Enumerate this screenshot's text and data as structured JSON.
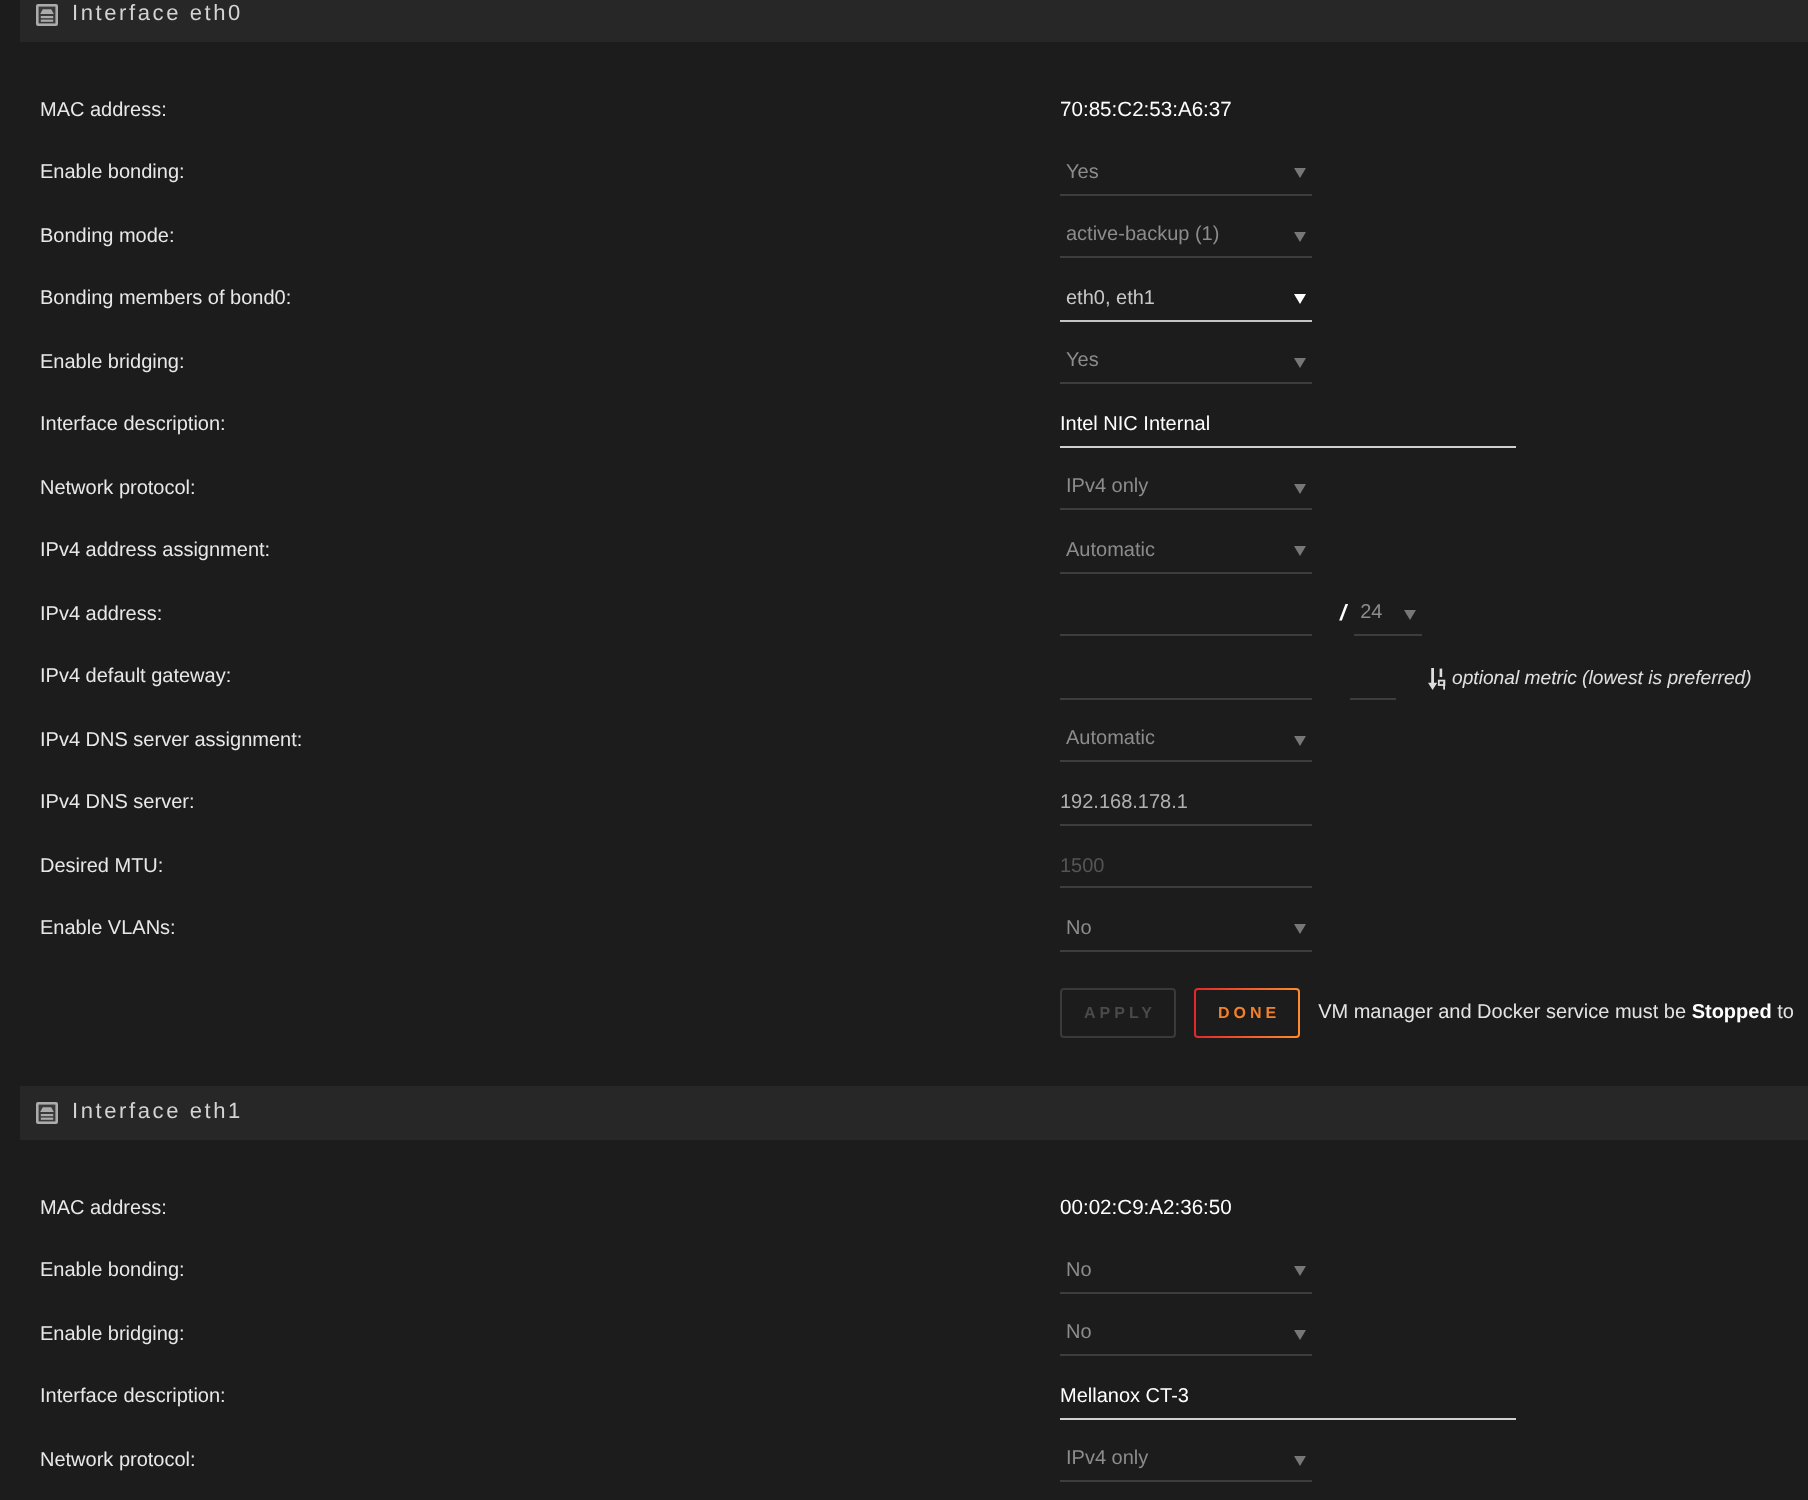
{
  "sections": [
    {
      "title": "Interface eth0",
      "rows": [
        {
          "label": "MAC address:",
          "fields": [
            {
              "kind": "static",
              "value": "70:85:C2:53:A6:37"
            }
          ]
        },
        {
          "label": "Enable bonding:",
          "fields": [
            {
              "kind": "select",
              "value": "Yes",
              "disabled": true
            }
          ]
        },
        {
          "label": "Bonding mode:",
          "fields": [
            {
              "kind": "select",
              "value": "active-backup (1)",
              "disabled": true
            }
          ]
        },
        {
          "label": "Bonding members of bond0:",
          "fields": [
            {
              "kind": "select",
              "value": "eth0, eth1",
              "disabled": false
            }
          ]
        },
        {
          "label": "Enable bridging:",
          "fields": [
            {
              "kind": "select",
              "value": "Yes",
              "disabled": true
            }
          ]
        },
        {
          "label": "Interface description:",
          "fields": [
            {
              "kind": "wide-input",
              "value": "Intel NIC Internal",
              "disabled": false
            }
          ]
        },
        {
          "label": "Network protocol:",
          "fields": [
            {
              "kind": "select",
              "value": "IPv4 only",
              "disabled": true
            }
          ]
        },
        {
          "label": "IPv4 address assignment:",
          "fields": [
            {
              "kind": "select",
              "value": "Automatic",
              "disabled": true
            }
          ]
        },
        {
          "label": "IPv4 address:",
          "fields": [
            {
              "kind": "input",
              "disabled": true
            },
            {
              "kind": "separator",
              "text": "/"
            },
            {
              "kind": "prefix-select",
              "value": "24",
              "disabled": true
            }
          ]
        },
        {
          "label": "IPv4 default gateway:",
          "fields": [
            {
              "kind": "input",
              "disabled": true
            },
            {
              "kind": "metric-input",
              "disabled": true
            },
            {
              "kind": "hint",
              "text": "optional metric (lowest is preferred)"
            }
          ]
        },
        {
          "label": "IPv4 DNS server assignment:",
          "fields": [
            {
              "kind": "select",
              "value": "Automatic",
              "disabled": true
            }
          ]
        },
        {
          "label": "IPv4 DNS server:",
          "fields": [
            {
              "kind": "input",
              "value": "192.168.178.1",
              "disabled": true
            }
          ]
        },
        {
          "label": "Desired MTU:",
          "fields": [
            {
              "kind": "input",
              "placeholder": "1500",
              "disabled": true
            }
          ]
        },
        {
          "label": "Enable VLANs:",
          "fields": [
            {
              "kind": "select",
              "value": "No",
              "disabled": true
            }
          ]
        }
      ],
      "buttons": [
        {
          "label": "APPLY",
          "disabled": true
        },
        {
          "label": "DONE",
          "disabled": false
        }
      ],
      "notice": "VM manager and Docker service must be **Stopped** to"
    },
    {
      "title": "Interface eth1",
      "rows": [
        {
          "label": "MAC address:",
          "fields": [
            {
              "kind": "static",
              "value": "00:02:C9:A2:36:50"
            }
          ]
        },
        {
          "label": "Enable bonding:",
          "fields": [
            {
              "kind": "select",
              "value": "No",
              "disabled": true
            }
          ]
        },
        {
          "label": "Enable bridging:",
          "fields": [
            {
              "kind": "select",
              "value": "No",
              "disabled": true
            }
          ]
        },
        {
          "label": "Interface description:",
          "fields": [
            {
              "kind": "wide-input",
              "value": "Mellanox CT-3",
              "disabled": false
            }
          ]
        },
        {
          "label": "Network protocol:",
          "fields": [
            {
              "kind": "select",
              "value": "IPv4 only",
              "disabled": true
            }
          ]
        }
      ]
    }
  ]
}
